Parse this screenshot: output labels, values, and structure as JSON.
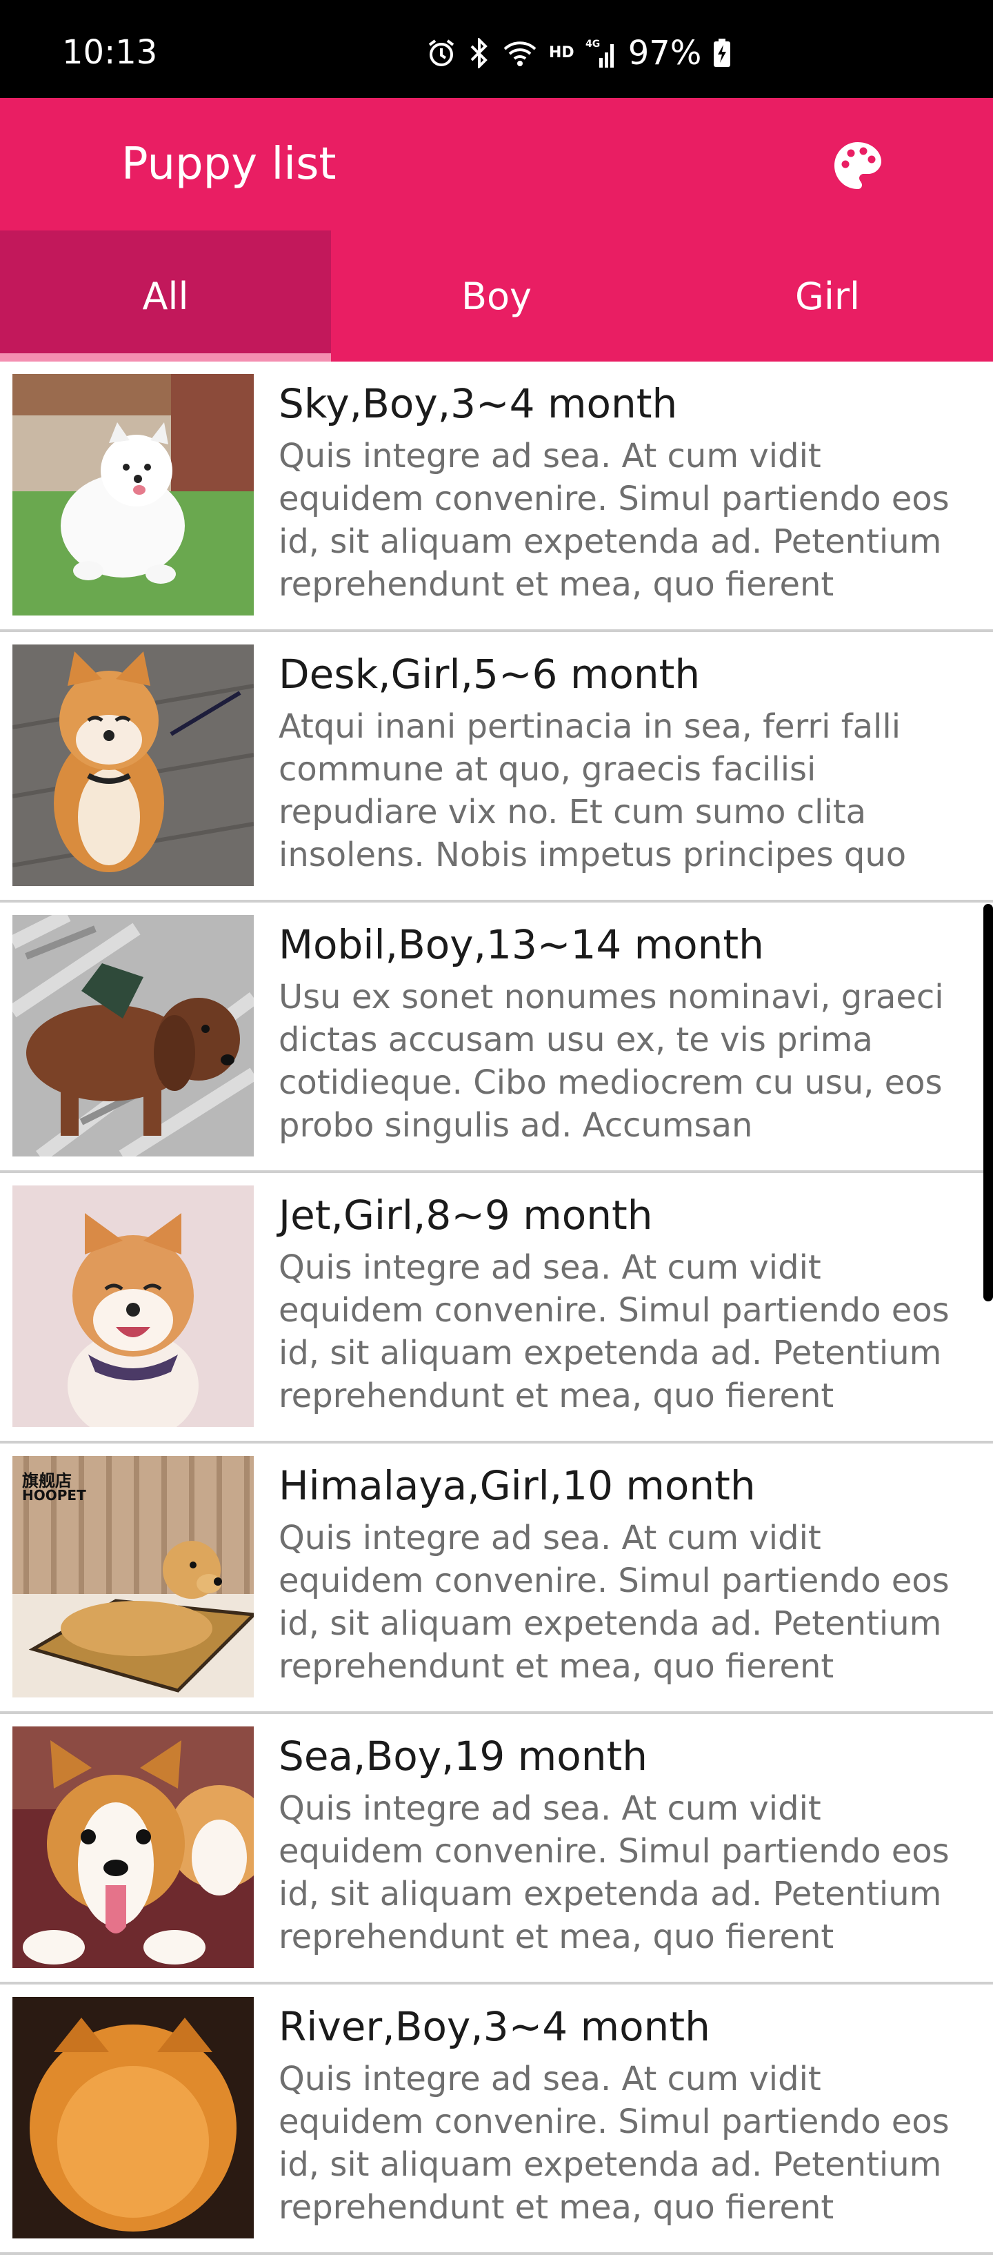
{
  "status": {
    "time": "10:13",
    "hd": "HD",
    "network": "4G",
    "battery": "97%",
    "icons": [
      "alarm-icon",
      "bluetooth-icon",
      "wifi-icon",
      "signal-icon",
      "battery-charging-icon"
    ]
  },
  "appbar": {
    "title": "Puppy list",
    "action_icon": "palette-icon",
    "color": "#e91e63"
  },
  "tabs": [
    {
      "label": "All",
      "selected": true
    },
    {
      "label": "Boy",
      "selected": false
    },
    {
      "label": "Girl",
      "selected": false
    }
  ],
  "items": [
    {
      "title": "Sky,Boy,3~4 month",
      "description": "Quis integre ad sea. At cum vidit equidem convenire. Simul partiendo eos id, sit aliquam expetenda ad. Petentium reprehendunt et mea, quo fierent"
    },
    {
      "title": "Desk,Girl,5~6 month",
      "description": "Atqui inani pertinacia in sea, ferri falli commune at quo, graecis facilisi repudiare vix no. Et cum sumo clita insolens. Nobis impetus principes quo"
    },
    {
      "title": "Mobil,Boy,13~14 month",
      "description": "Usu ex sonet nonumes nominavi, graeci dictas accusam usu ex, te vis prima cotidieque. Cibo mediocrem cu usu, eos probo singulis ad. Accumsan"
    },
    {
      "title": "Jet,Girl,8~9 month",
      "description": "Quis integre ad sea. At cum vidit equidem convenire. Simul partiendo eos id, sit aliquam expetenda ad. Petentium reprehendunt et mea, quo fierent"
    },
    {
      "title": "Himalaya,Girl,10 month",
      "description": "Quis integre ad sea. At cum vidit equidem convenire. Simul partiendo eos id, sit aliquam expetenda ad. Petentium reprehendunt et mea, quo fierent",
      "watermark": "旗舰店 HOOPET"
    },
    {
      "title": "Sea,Boy,19 month",
      "description": "Quis integre ad sea. At cum vidit equidem convenire. Simul partiendo eos id, sit aliquam expetenda ad. Petentium reprehendunt et mea, quo fierent"
    },
    {
      "title": "River,Boy,3~4 month",
      "description": "Quis integre ad sea. At cum vidit equidem convenire. Simul partiendo eos id, sit aliquam expetenda ad. Petentium reprehendunt et mea, quo fierent"
    }
  ]
}
